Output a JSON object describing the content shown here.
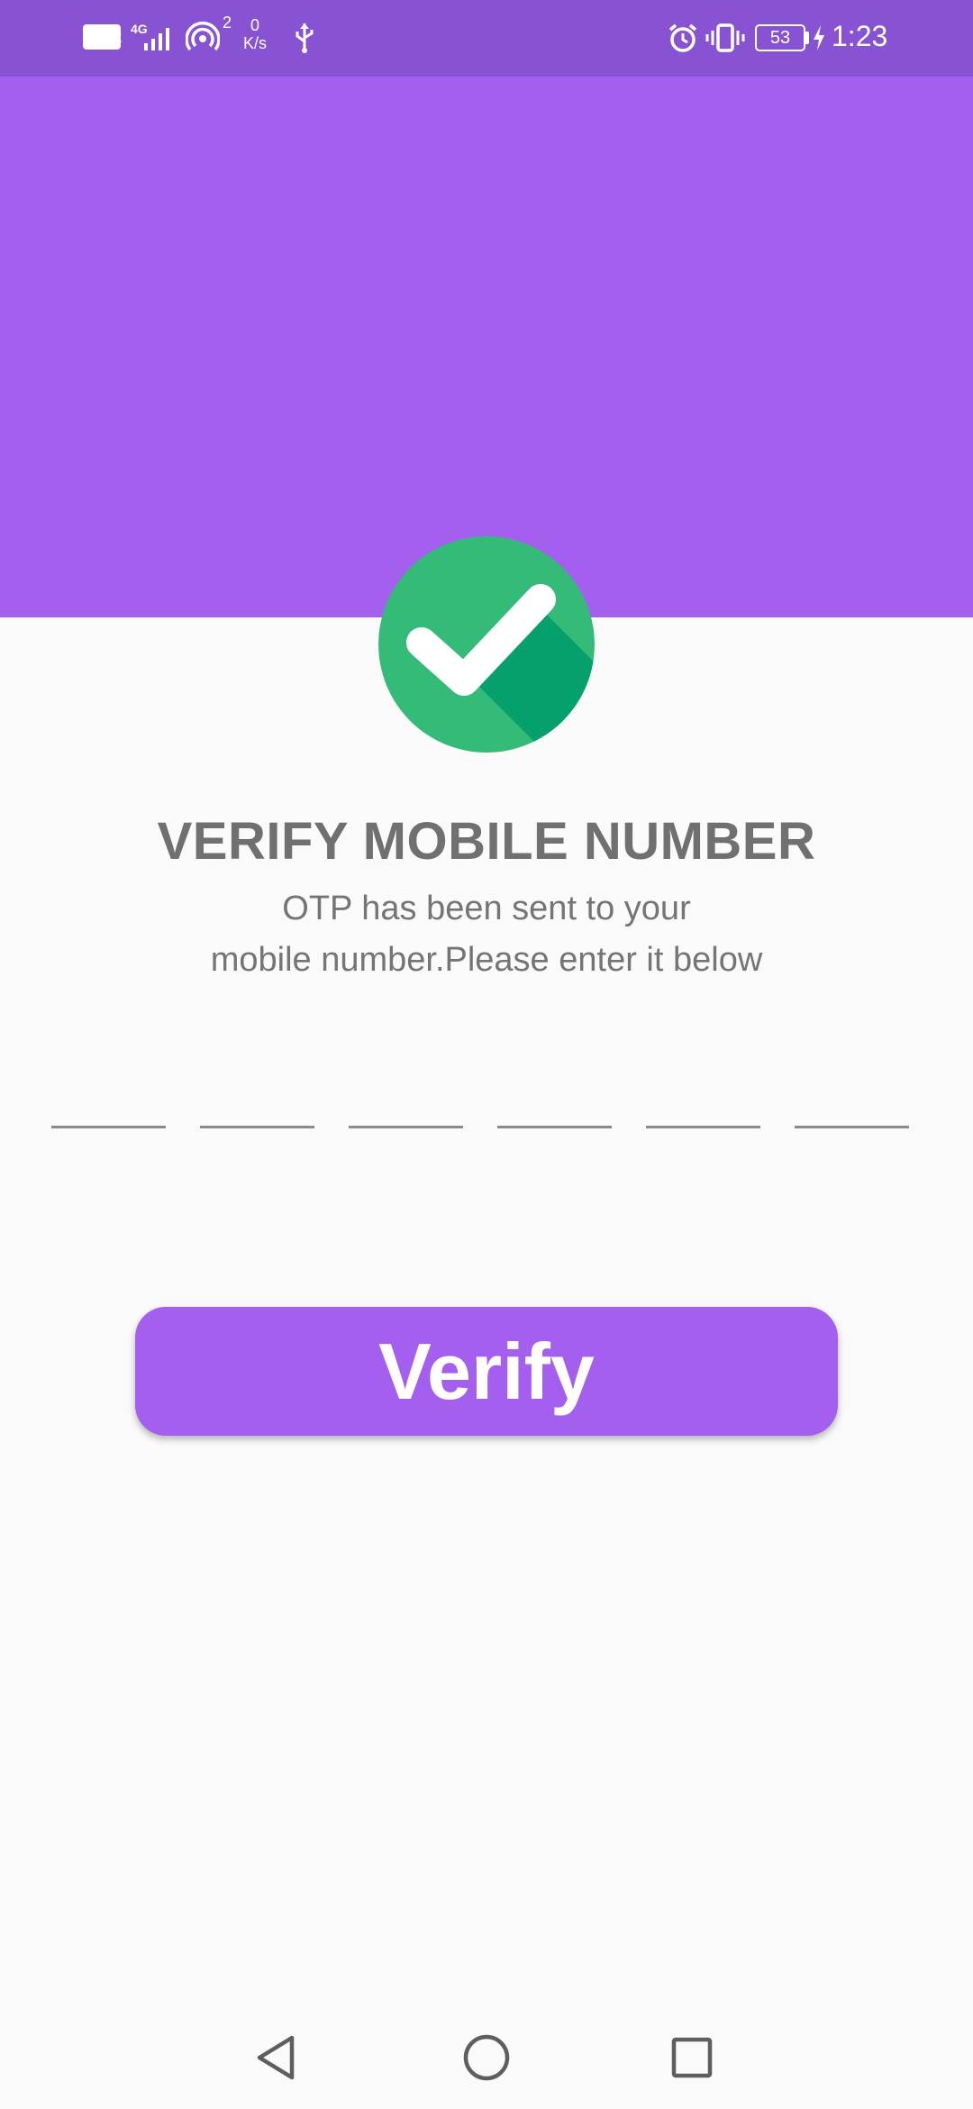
{
  "status_bar": {
    "volte": "VoLTE",
    "network": "4G",
    "hotspot_count": "2",
    "speed_value": "0",
    "speed_unit": "K/s",
    "battery": "53",
    "time": "1:23",
    "icons": [
      "signal-icon",
      "hotspot-icon",
      "usb-icon",
      "alarm-icon",
      "vibrate-icon",
      "battery-icon",
      "charging-icon"
    ]
  },
  "colors": {
    "status_bar": "#8753d2",
    "accent": "#a45fee",
    "check_green": "#35bb78",
    "check_shadow": "#06a06d",
    "background": "#fafafa"
  },
  "verify": {
    "title": "VERIFY MOBILE NUMBER",
    "subtitle_line1": "OTP has been sent to your",
    "subtitle_line2": "mobile number.Please enter it below",
    "otp_digits": [
      "",
      "",
      "",
      "",
      "",
      ""
    ],
    "button_label": "Verify",
    "check_icon": "check-circle-icon"
  },
  "nav": {
    "icons": [
      "back-icon",
      "home-icon",
      "recents-icon"
    ]
  }
}
